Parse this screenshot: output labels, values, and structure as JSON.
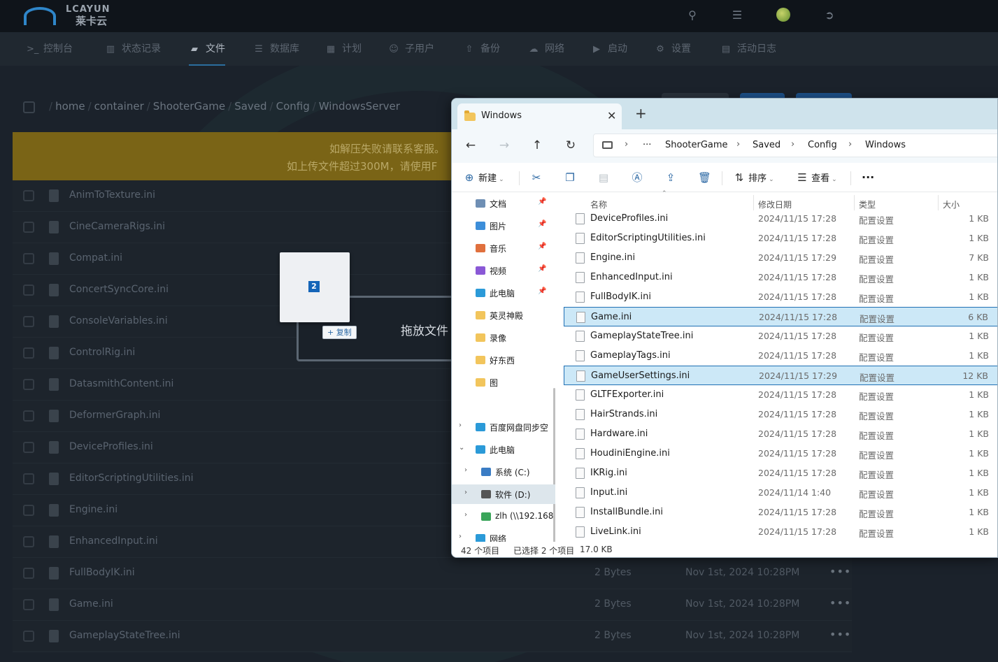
{
  "panel": {
    "logo": {
      "text_en": "LCAYUN",
      "text_cn": "莱卡云"
    },
    "nav": [
      {
        "label": "控制台",
        "icon": "terminal-icon"
      },
      {
        "label": "状态记录",
        "icon": "chart-icon"
      },
      {
        "label": "文件",
        "icon": "folder-icon",
        "active": true
      },
      {
        "label": "数据库",
        "icon": "database-icon"
      },
      {
        "label": "计划",
        "icon": "calendar-icon"
      },
      {
        "label": "子用户",
        "icon": "users-icon"
      },
      {
        "label": "备份",
        "icon": "upload-icon"
      },
      {
        "label": "网络",
        "icon": "cloud-icon"
      },
      {
        "label": "启动",
        "icon": "play-icon"
      },
      {
        "label": "设置",
        "icon": "gears-icon"
      },
      {
        "label": "活动日志",
        "icon": "log-icon"
      }
    ],
    "breadcrumb": [
      "home",
      "container",
      "ShooterGame",
      "Saved",
      "Config",
      "WindowsServer"
    ],
    "breadcrumb_sep": "/",
    "banner": {
      "line1": "如解压失败请联系客服。",
      "line2": "如上传文件超过300M，请使用F"
    },
    "files": [
      {
        "name": "AnimToTexture.ini"
      },
      {
        "name": "CineCameraRigs.ini"
      },
      {
        "name": "Compat.ini"
      },
      {
        "name": "ConcertSyncCore.ini"
      },
      {
        "name": "ConsoleVariables.ini"
      },
      {
        "name": "ControlRig.ini"
      },
      {
        "name": "DatasmithContent.ini"
      },
      {
        "name": "DeformerGraph.ini"
      },
      {
        "name": "DeviceProfiles.ini"
      },
      {
        "name": "EditorScriptingUtilities.ini"
      },
      {
        "name": "Engine.ini"
      },
      {
        "name": "EnhancedInput.ini"
      },
      {
        "name": "FullBodyIK.ini",
        "size": "2 Bytes",
        "date": "Nov 1st, 2024 10:28PM"
      },
      {
        "name": "Game.ini",
        "size": "2 Bytes",
        "date": "Nov 1st, 2024 10:28PM"
      },
      {
        "name": "GameplayStateTree.ini",
        "size": "2 Bytes",
        "date": "Nov 1st, 2024 10:28PM"
      }
    ],
    "row_menu": "•••",
    "dropzone_text": "拖放文件",
    "drag": {
      "count": "2",
      "copy_label": "复制"
    }
  },
  "explorer": {
    "tab_title": "Windows",
    "address": [
      "ShooterGame",
      "Saved",
      "Config",
      "Windows"
    ],
    "address_more": "···",
    "commands": {
      "new": "新建",
      "sort": "排序",
      "view": "查看",
      "more": "···"
    },
    "nav_items": [
      {
        "label": "文档",
        "icon": "documents-icon",
        "color": "#6f8fb4",
        "pinned": true
      },
      {
        "label": "图片",
        "icon": "pictures-icon",
        "color": "#3d8ed9",
        "pinned": true
      },
      {
        "label": "音乐",
        "icon": "music-icon",
        "color": "#e0703d",
        "pinned": true
      },
      {
        "label": "视频",
        "icon": "videos-icon",
        "color": "#8a58d6",
        "pinned": true
      },
      {
        "label": "此电脑",
        "icon": "this-pc-icon",
        "color": "#2b9ad8",
        "pinned": true
      },
      {
        "label": "英灵神殿",
        "icon": "folder-icon",
        "color": "#f2c55c"
      },
      {
        "label": "录像",
        "icon": "folder-icon",
        "color": "#f2c55c"
      },
      {
        "label": "好东西",
        "icon": "folder-icon",
        "color": "#f2c55c"
      },
      {
        "label": "图",
        "icon": "folder-icon",
        "color": "#f2c55c"
      }
    ],
    "tree_items": [
      {
        "label": "百度网盘同步空",
        "icon": "baidu-sync-icon",
        "color": "#2b9ad8",
        "expander": "›"
      },
      {
        "label": "此电脑",
        "icon": "this-pc-icon",
        "color": "#2b9ad8",
        "expander": "⌄"
      },
      {
        "label": "系统 (C:)",
        "icon": "windows-drive-icon",
        "color": "#3a7cc4",
        "expander": "›"
      },
      {
        "label": "软件 (D:)",
        "icon": "drive-icon",
        "color": "#555555",
        "expander": "›",
        "selected": true
      },
      {
        "label": "zlh (\\\\192.168",
        "icon": "network-drive-icon",
        "color": "#3aa55a",
        "expander": "›"
      },
      {
        "label": "网络",
        "icon": "network-icon",
        "color": "#2b9ad8",
        "expander": "›"
      }
    ],
    "columns": {
      "name": "名称",
      "date": "修改日期",
      "type": "类型",
      "size": "大小"
    },
    "rows": [
      {
        "name": "DeviceProfiles.ini",
        "date": "2024/11/15 17:28",
        "type": "配置设置",
        "size": "1 KB"
      },
      {
        "name": "EditorScriptingUtilities.ini",
        "date": "2024/11/15 17:28",
        "type": "配置设置",
        "size": "1 KB"
      },
      {
        "name": "Engine.ini",
        "date": "2024/11/15 17:29",
        "type": "配置设置",
        "size": "7 KB"
      },
      {
        "name": "EnhancedInput.ini",
        "date": "2024/11/15 17:28",
        "type": "配置设置",
        "size": "1 KB"
      },
      {
        "name": "FullBodyIK.ini",
        "date": "2024/11/15 17:28",
        "type": "配置设置",
        "size": "1 KB"
      },
      {
        "name": "Game.ini",
        "date": "2024/11/15 17:28",
        "type": "配置设置",
        "size": "6 KB",
        "selected": true
      },
      {
        "name": "GameplayStateTree.ini",
        "date": "2024/11/15 17:28",
        "type": "配置设置",
        "size": "1 KB"
      },
      {
        "name": "GameplayTags.ini",
        "date": "2024/11/15 17:28",
        "type": "配置设置",
        "size": "1 KB"
      },
      {
        "name": "GameUserSettings.ini",
        "date": "2024/11/15 17:29",
        "type": "配置设置",
        "size": "12 KB",
        "selected": true
      },
      {
        "name": "GLTFExporter.ini",
        "date": "2024/11/15 17:28",
        "type": "配置设置",
        "size": "1 KB"
      },
      {
        "name": "HairStrands.ini",
        "date": "2024/11/15 17:28",
        "type": "配置设置",
        "size": "1 KB"
      },
      {
        "name": "Hardware.ini",
        "date": "2024/11/15 17:28",
        "type": "配置设置",
        "size": "1 KB"
      },
      {
        "name": "HoudiniEngine.ini",
        "date": "2024/11/15 17:28",
        "type": "配置设置",
        "size": "1 KB"
      },
      {
        "name": "IKRig.ini",
        "date": "2024/11/15 17:28",
        "type": "配置设置",
        "size": "1 KB"
      },
      {
        "name": "Input.ini",
        "date": "2024/11/14 1:40",
        "type": "配置设置",
        "size": "1 KB"
      },
      {
        "name": "InstallBundle.ini",
        "date": "2024/11/15 17:28",
        "type": "配置设置",
        "size": "1 KB"
      },
      {
        "name": "LiveLink.ini",
        "date": "2024/11/15 17:28",
        "type": "配置设置",
        "size": "1 KB"
      }
    ],
    "status": {
      "count": "42 个项目",
      "selected": "已选择 2 个项目",
      "size": "17.0 KB"
    }
  }
}
